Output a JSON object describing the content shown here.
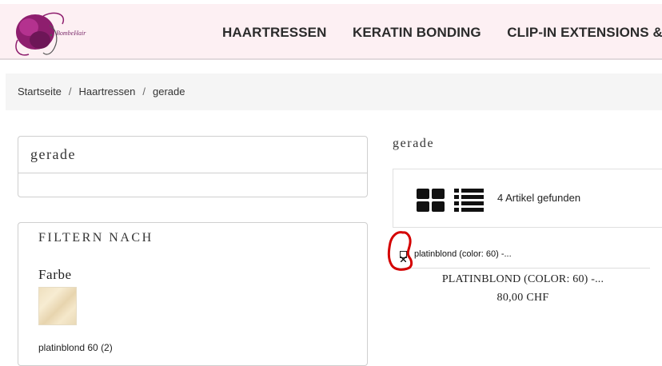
{
  "header": {
    "logo_text": "BombeHair",
    "nav": [
      "HAARTRESSEN",
      "KERATIN BONDING",
      "CLIP-IN EXTENSIONS & PO"
    ]
  },
  "breadcrumb": [
    "Startseite",
    "Haartressen",
    "gerade"
  ],
  "sidebar": {
    "category_title": "gerade",
    "filter_title": "FILTERN NACH",
    "facet_title": "Farbe",
    "facet_value": "platinblond 60 (2)"
  },
  "main": {
    "title": "gerade",
    "result_count": "4 Artikel gefunden",
    "product": {
      "image_alt": "platinblond (color: 60) -...",
      "name": "PLATINBLOND (COLOR: 60) -...",
      "price": "80,00 CHF"
    }
  },
  "colors": {
    "header_bg": "#fdf0f3",
    "logo_purple": "#8e1e6e",
    "annotation_red": "#d40000"
  },
  "icons": [
    "logo-icon",
    "grid-view-icon",
    "list-view-icon",
    "broken-image-icon"
  ]
}
